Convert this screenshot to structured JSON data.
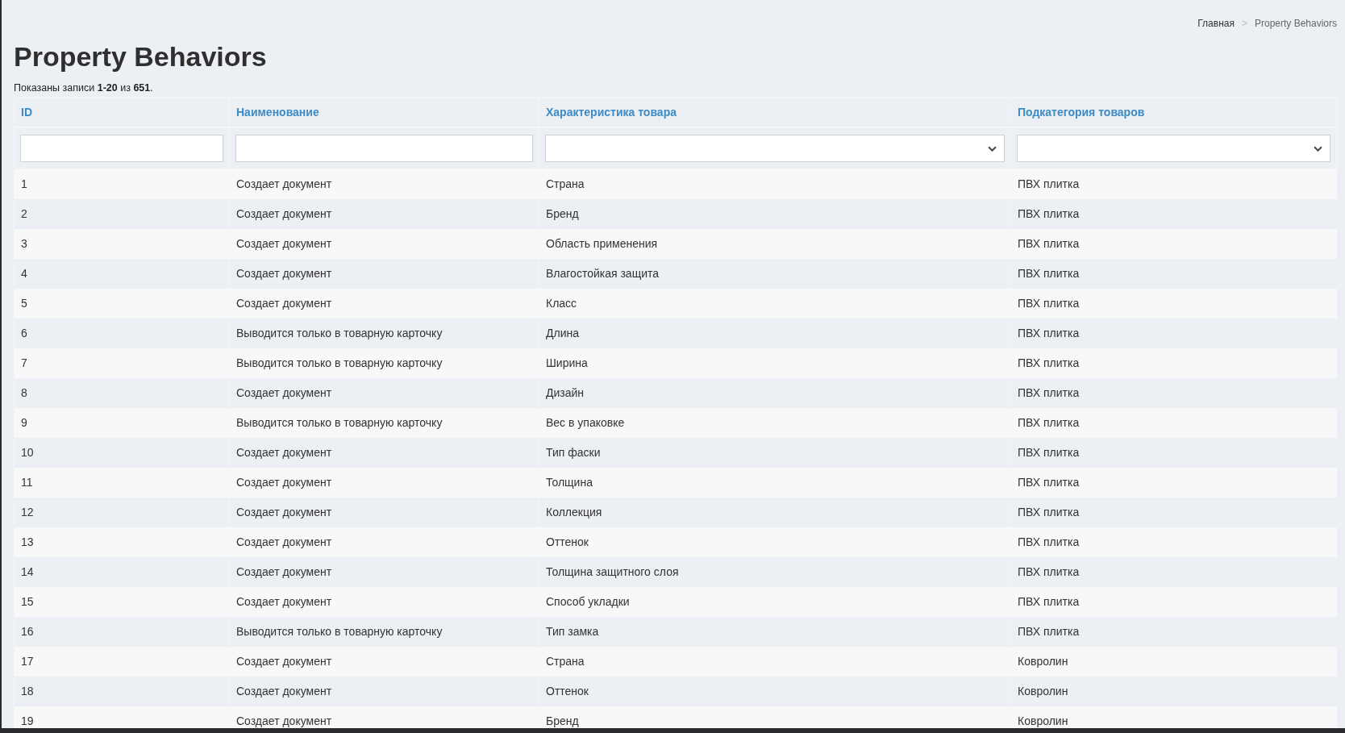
{
  "breadcrumb": [
    {
      "label": "Главная",
      "kind": "link"
    },
    {
      "label": ">",
      "kind": "separator"
    },
    {
      "label": "Property Behaviors",
      "kind": "current"
    }
  ],
  "title": "Property Behaviors",
  "summary": "Показаны записи **1-20** из **651**.",
  "table": {
    "columns": [
      {
        "label": "ID",
        "kind": "text"
      },
      {
        "label": "Наименование",
        "kind": "text"
      },
      {
        "label": "Характеристика товара",
        "kind": "select"
      },
      {
        "label": "Подкатегория товаров",
        "kind": "select"
      }
    ],
    "rows": [
      [
        "1",
        "Создает документ",
        "Страна",
        "ПВХ плитка"
      ],
      [
        "2",
        "Создает документ",
        "Бренд",
        "ПВХ плитка"
      ],
      [
        "3",
        "Создает документ",
        "Область применения",
        "ПВХ плитка"
      ],
      [
        "4",
        "Создает документ",
        "Влагостойкая защита",
        "ПВХ плитка"
      ],
      [
        "5",
        "Создает документ",
        "Класс",
        "ПВХ плитка"
      ],
      [
        "6",
        "Выводится только в товарную карточку",
        "Длина",
        "ПВХ плитка"
      ],
      [
        "7",
        "Выводится только в товарную карточку",
        "Ширина",
        "ПВХ плитка"
      ],
      [
        "8",
        "Создает документ",
        "Дизайн",
        "ПВХ плитка"
      ],
      [
        "9",
        "Выводится только в товарную карточку",
        "Вес в упаковке",
        "ПВХ плитка"
      ],
      [
        "10",
        "Создает документ",
        "Тип фаски",
        "ПВХ плитка"
      ],
      [
        "11",
        "Создает документ",
        "Толщина",
        "ПВХ плитка"
      ],
      [
        "12",
        "Создает документ",
        "Коллекция",
        "ПВХ плитка"
      ],
      [
        "13",
        "Создает документ",
        "Оттенок",
        "ПВХ плитка"
      ],
      [
        "14",
        "Создает документ",
        "Толщина защитного слоя",
        "ПВХ плитка"
      ],
      [
        "15",
        "Создает документ",
        "Способ укладки",
        "ПВХ плитка"
      ],
      [
        "16",
        "Выводится только в товарную карточку",
        "Тип замка",
        "ПВХ плитка"
      ],
      [
        "17",
        "Создает документ",
        "Страна",
        "Ковролин"
      ],
      [
        "18",
        "Создает документ",
        "Оттенок",
        "Ковролин"
      ],
      [
        "19",
        "Создает документ",
        "Бренд",
        "Ковролин"
      ]
    ]
  }
}
